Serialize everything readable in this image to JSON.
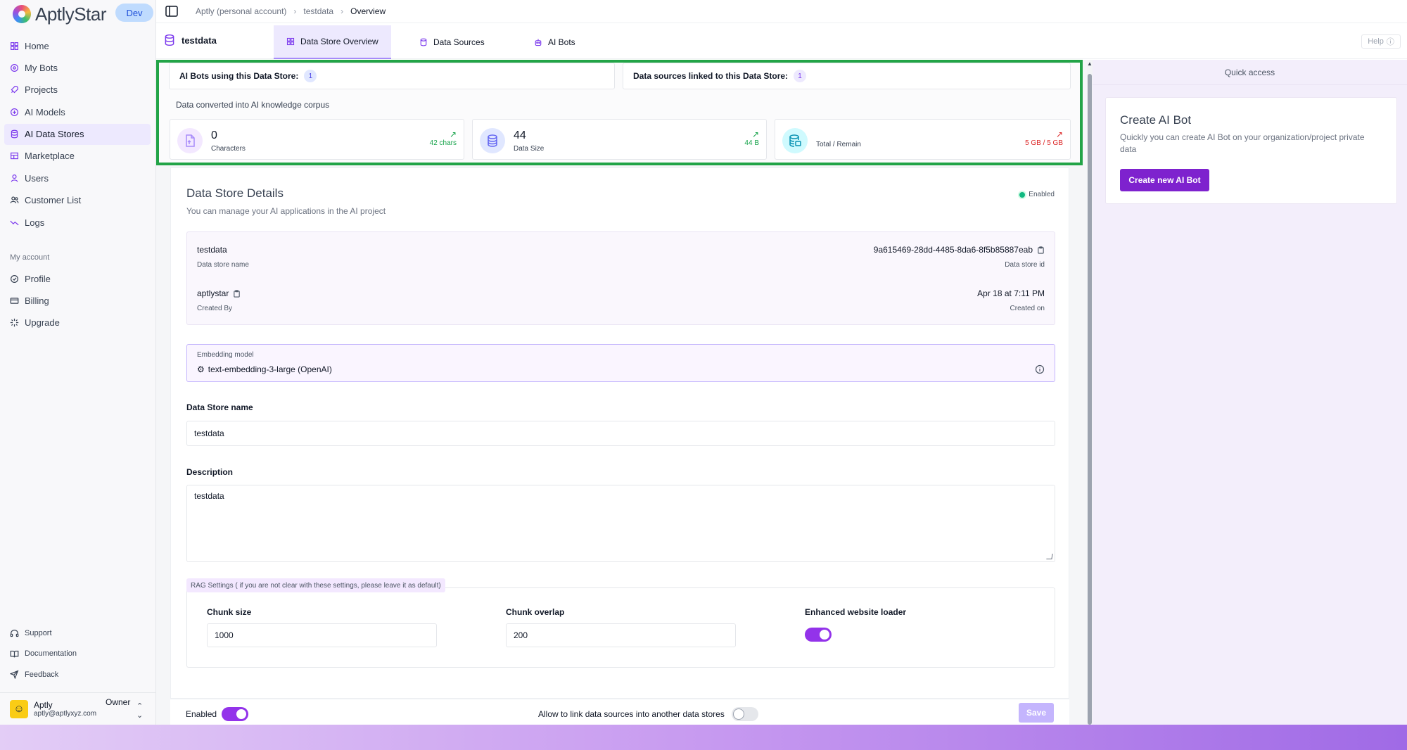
{
  "app": {
    "name": "AptlyStar",
    "env_badge": "Dev"
  },
  "sidebar": {
    "items": [
      {
        "label": "Home",
        "icon": "grid-icon"
      },
      {
        "label": "My Bots",
        "icon": "bot-icon"
      },
      {
        "label": "Projects",
        "icon": "rocket-icon"
      },
      {
        "label": "AI Models",
        "icon": "model-icon"
      },
      {
        "label": "AI Data Stores",
        "icon": "database-icon",
        "active": true
      },
      {
        "label": "Marketplace",
        "icon": "store-icon"
      },
      {
        "label": "Users",
        "icon": "user-icon"
      },
      {
        "label": "Customer List",
        "icon": "users-icon"
      },
      {
        "label": "Logs",
        "icon": "trend-icon"
      }
    ],
    "section_label": "My account",
    "account_items": [
      {
        "label": "Profile",
        "icon": "profile-icon"
      },
      {
        "label": "Billing",
        "icon": "card-icon"
      },
      {
        "label": "Upgrade",
        "icon": "sparkle-icon"
      }
    ],
    "bottom_links": [
      {
        "label": "Support",
        "icon": "headset-icon"
      },
      {
        "label": "Documentation",
        "icon": "book-icon"
      },
      {
        "label": "Feedback",
        "icon": "send-icon"
      }
    ],
    "user": {
      "name": "Aptly",
      "email": "aptly@aptlyxyz.com",
      "role": "Owner"
    }
  },
  "breadcrumb": {
    "account": "Aptly (personal account)",
    "store": "testdata",
    "current": "Overview"
  },
  "tabbar": {
    "datastore_name": "testdata",
    "tabs": [
      {
        "label": "Data Store Overview",
        "active": true
      },
      {
        "label": "Data Sources"
      },
      {
        "label": "AI Bots"
      }
    ],
    "help_label": "Help"
  },
  "stats": {
    "bots_using_label": "AI Bots using this Data Store:",
    "bots_using_count": "1",
    "sources_linked_label": "Data sources linked to this Data Store:",
    "sources_linked_count": "1",
    "corpus_label": "Data converted into AI knowledge corpus",
    "metrics": [
      {
        "value": "0",
        "label": "Characters",
        "trend": "42 chars",
        "trend_color": "#16a34a"
      },
      {
        "value": "44",
        "label": "Data Size",
        "trend": "44 B",
        "trend_color": "#16a34a"
      },
      {
        "value": "",
        "label": "Total / Remain",
        "trend": "5 GB / 5 GB",
        "trend_color": "#dc2626"
      }
    ]
  },
  "details": {
    "title": "Data Store Details",
    "subtitle": "You can manage your AI applications in the AI project",
    "status": "Enabled",
    "name_value": "testdata",
    "name_label": "Data store name",
    "id_value": "9a615469-28dd-4485-8da6-8f5b85887eab",
    "id_label": "Data store id",
    "created_by_value": "aptlystar",
    "created_by_label": "Created By",
    "created_on_value": "Apr 18 at 7:11 PM",
    "created_on_label": "Created on",
    "embedding_label": "Embedding model",
    "embedding_value": "text-embedding-3-large (OpenAI)",
    "store_name_label": "Data Store name",
    "store_name_value": "testdata",
    "description_label": "Description",
    "description_value": "testdata",
    "rag_label": "RAG Settings ( if you are not clear with these settings, please leave it as default)",
    "chunk_size_label": "Chunk size",
    "chunk_size_value": "1000",
    "chunk_overlap_label": "Chunk overlap",
    "chunk_overlap_value": "200",
    "enhanced_loader_label": "Enhanced website loader",
    "enhanced_loader_on": true
  },
  "footer": {
    "enabled_label": "Enabled",
    "enabled_on": true,
    "allow_link_label": "Allow to link data sources into another data stores",
    "allow_link_on": false,
    "save_label": "Save"
  },
  "quick_access": {
    "header": "Quick access",
    "card_title": "Create AI Bot",
    "card_subtitle": "Quickly you can create AI Bot on your organization/project private data",
    "button_label": "Create new AI Bot"
  },
  "colors": {
    "accent": "#7e22ce",
    "highlight_frame": "#22a447"
  }
}
